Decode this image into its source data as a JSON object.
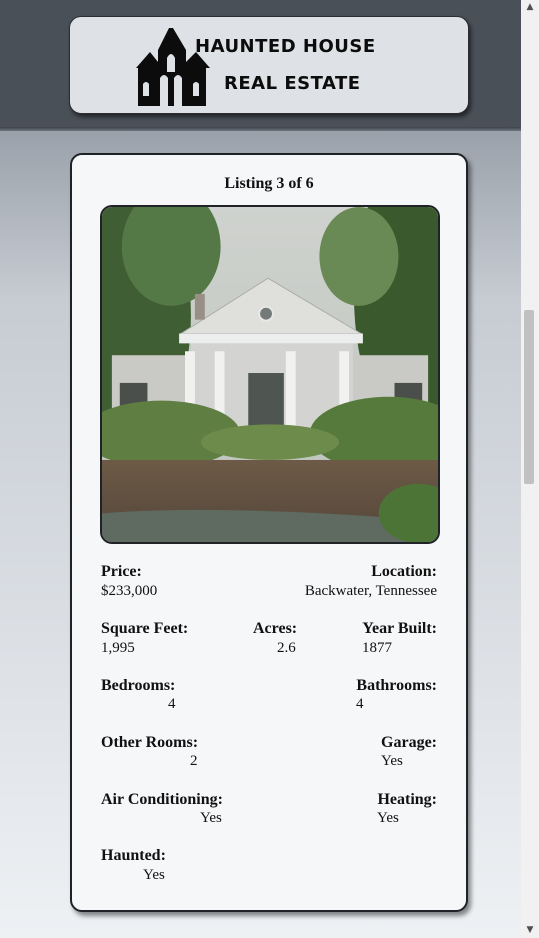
{
  "logo": {
    "line1": "HAUNTED HOUSE",
    "line2": "REAL ESTATE"
  },
  "listing": {
    "counter": "Listing 3 of 6",
    "photo_alt": "Abandoned white columned house overgrown with vines",
    "price_label": "Price:",
    "price": "$233,000",
    "location_label": "Location:",
    "location": "Backwater, Tennessee",
    "sqft_label": "Square Feet:",
    "sqft": "1,995",
    "acres_label": "Acres:",
    "acres": "2.6",
    "year_label": "Year Built:",
    "year": "1877",
    "bedrooms_label": "Bedrooms:",
    "bedrooms": "4",
    "bathrooms_label": "Bathrooms:",
    "bathrooms": "4",
    "other_rooms_label": "Other Rooms:",
    "other_rooms": "2",
    "garage_label": "Garage:",
    "garage": "Yes",
    "ac_label": "Air Conditioning:",
    "ac": "Yes",
    "heating_label": "Heating:",
    "heating": "Yes",
    "haunted_label": "Haunted:",
    "haunted": "Yes"
  },
  "scrollbar": {
    "up_arrow": "▲",
    "down_arrow": "▼"
  }
}
